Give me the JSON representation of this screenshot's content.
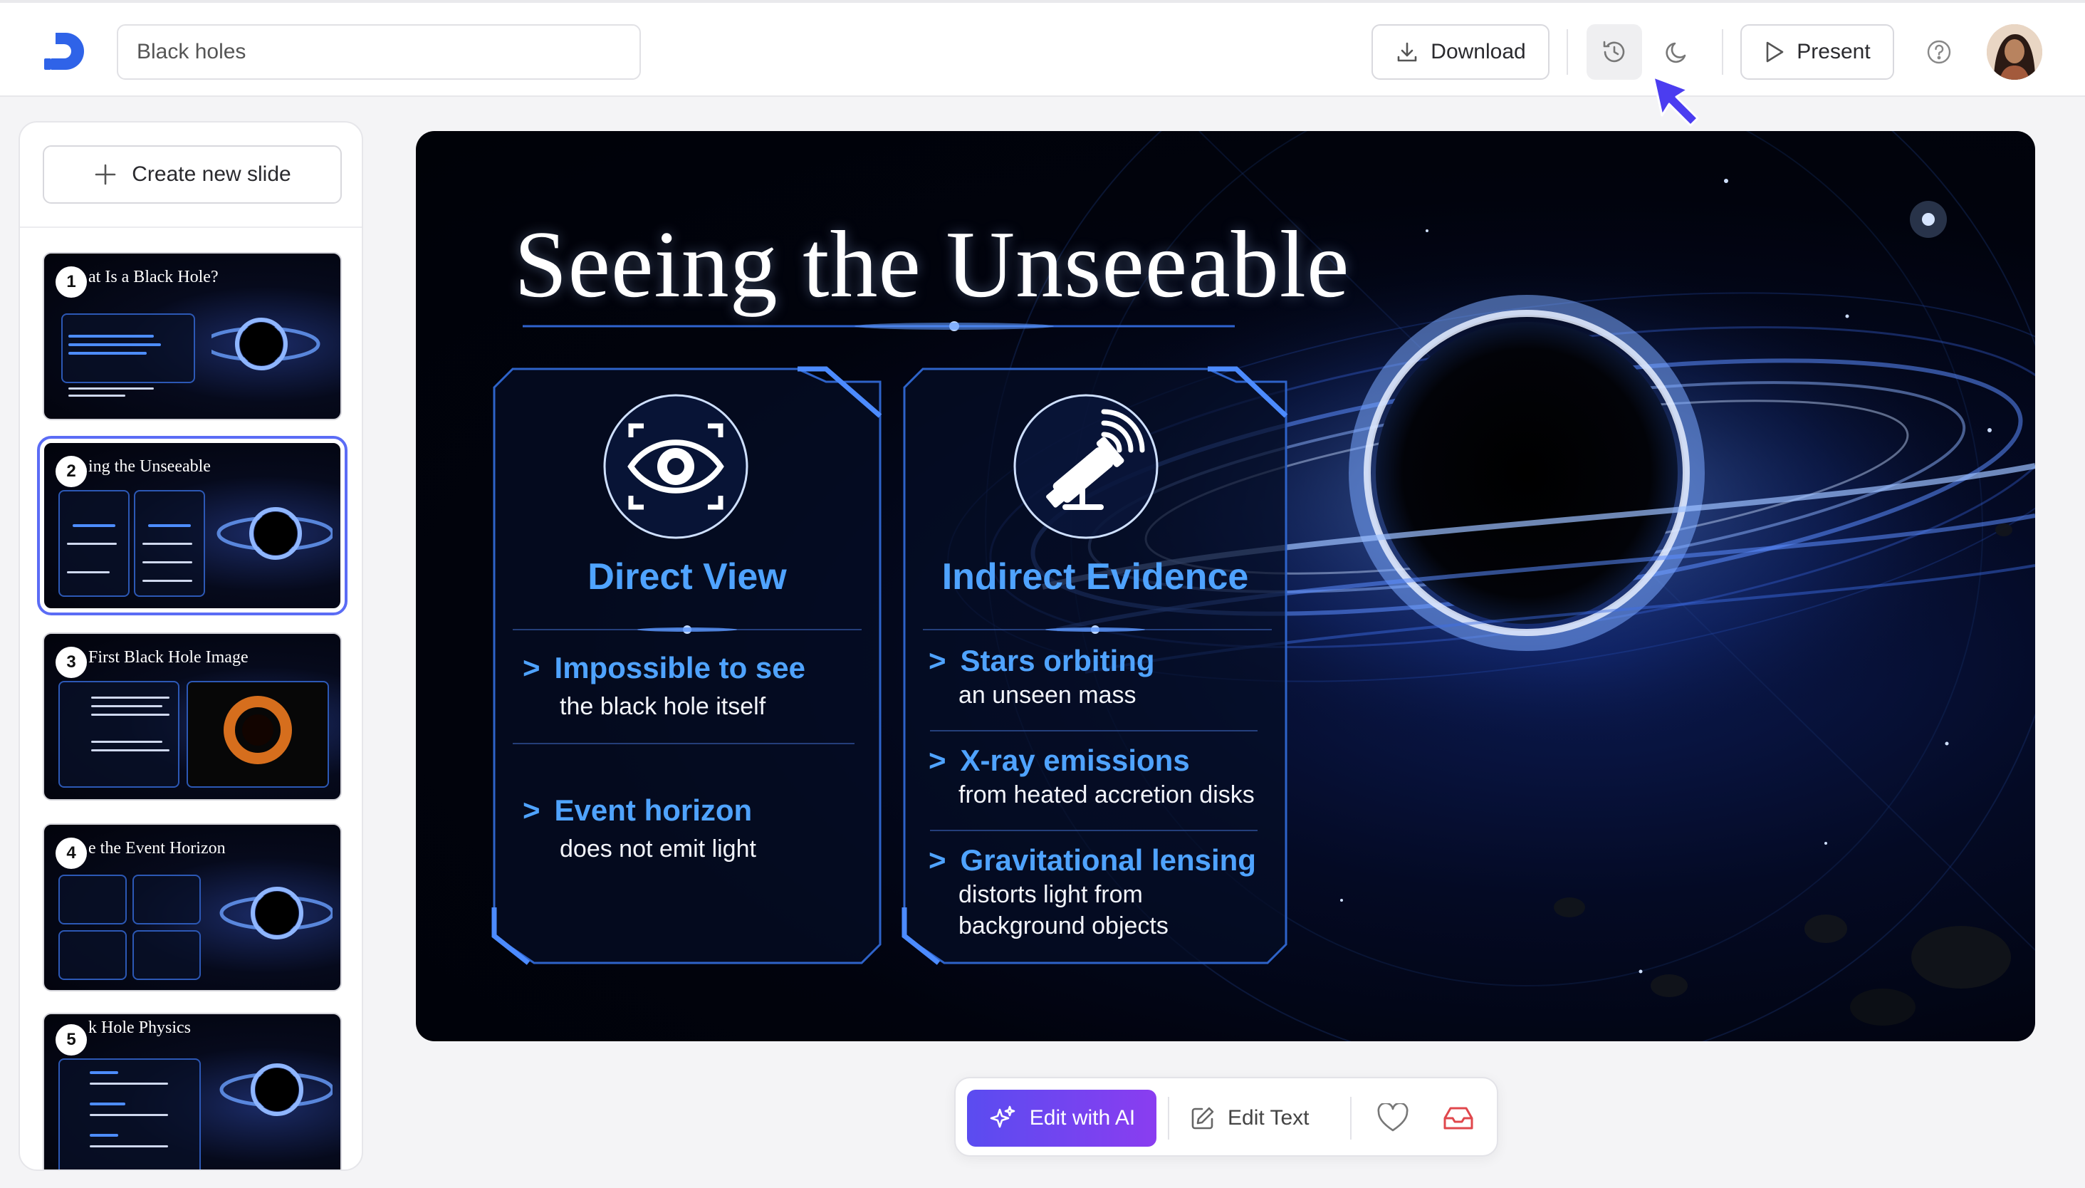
{
  "header": {
    "search_value": "Black holes",
    "download_label": "Download",
    "present_label": "Present"
  },
  "icons": {
    "logo": "brand-logo-icon",
    "download": "download-icon",
    "history": "history-icon",
    "theme": "moon-icon",
    "present": "play-icon",
    "help": "help-icon",
    "add": "plus-icon",
    "ai": "sparkles-icon",
    "edit": "pencil-icon",
    "like": "heart-icon",
    "archive": "inbox-icon"
  },
  "colors": {
    "accent": "#5b6cf5",
    "slide_heading": "#4fa3ff",
    "ai_gradient_start": "#5a4cf0",
    "ai_gradient_end": "#8a3df0",
    "archive_icon": "#e0474c"
  },
  "sidebar": {
    "create_label": "Create new slide",
    "slides": [
      {
        "num": "1",
        "title": "at Is a Black Hole?"
      },
      {
        "num": "2",
        "title": "ing the Unseeable"
      },
      {
        "num": "3",
        "title": "First Black Hole Image"
      },
      {
        "num": "4",
        "title": "e the Event Horizon"
      },
      {
        "num": "5",
        "title": "k Hole Physics"
      }
    ]
  },
  "slide": {
    "title": "Seeing the Unseeable",
    "cards": [
      {
        "heading": "Direct View",
        "items": [
          {
            "label": "Impossible to see",
            "text": "the black hole itself"
          },
          {
            "label": "Event horizon",
            "text": "does not emit light"
          }
        ]
      },
      {
        "heading": "Indirect Evidence",
        "items": [
          {
            "label": "Stars orbiting",
            "text": "an unseen mass"
          },
          {
            "label": "X-ray emissions",
            "text": "from heated accretion disks"
          },
          {
            "label": "Gravitational lensing",
            "text": "distorts light from background objects"
          }
        ]
      }
    ]
  },
  "toolbar": {
    "ai_label": "Edit with AI",
    "edit_text_label": "Edit Text"
  }
}
